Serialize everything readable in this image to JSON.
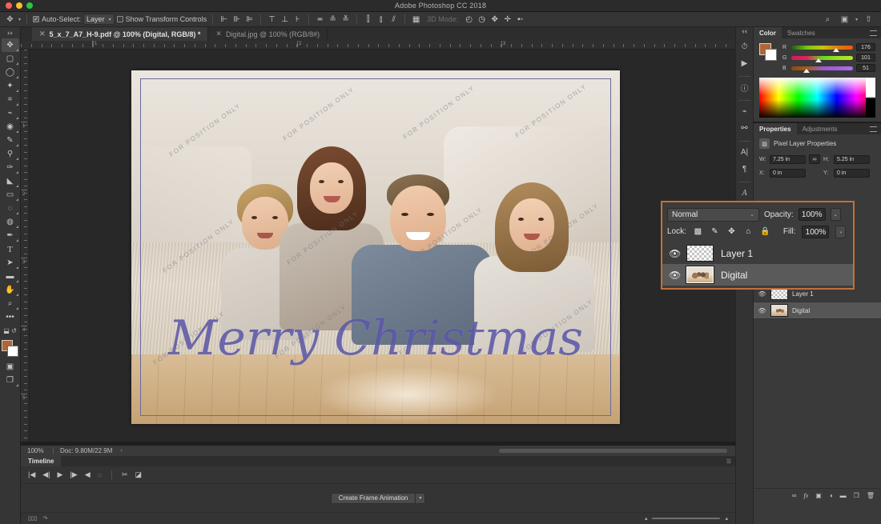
{
  "window": {
    "app_title": "Adobe Photoshop CC 2018"
  },
  "options_bar": {
    "auto_select_label": "Auto-Select:",
    "auto_select_checked": true,
    "layer_select_value": "Layer",
    "show_transform_label": "Show Transform Controls",
    "show_transform_checked": false,
    "mode_3d_label": "3D Mode:",
    "align_icons": [
      "align-left-edges-icon",
      "align-horizontal-centers-icon",
      "align-right-edges-icon",
      "align-top-edges-icon",
      "align-vertical-centers-icon",
      "align-bottom-edges-icon",
      "distribute-top-edges-icon",
      "distribute-vertical-centers-icon",
      "distribute-bottom-edges-icon",
      "distribute-left-edges-icon",
      "distribute-horizontal-centers-icon",
      "distribute-right-edges-icon"
    ],
    "right_icons": [
      "search-icon",
      "workspace-icon",
      "chevron-down-icon",
      "share-icon"
    ]
  },
  "tabs": [
    {
      "label": "5_x_7_A7_H-9.pdf @ 100% (Digital, RGB/8) *",
      "active": true
    },
    {
      "label": "Digital.jpg @ 100% (RGB/8#)",
      "active": false
    }
  ],
  "toolbar": {
    "tools": [
      {
        "name": "move-tool",
        "glyph": "✥",
        "selected": true
      },
      {
        "name": "rectangular-marquee-tool",
        "glyph": "▢"
      },
      {
        "name": "lasso-tool",
        "glyph": "◯"
      },
      {
        "name": "magic-wand-tool",
        "glyph": "✦"
      },
      {
        "name": "crop-tool",
        "glyph": "⌗"
      },
      {
        "name": "eyedropper-tool",
        "glyph": "⌁"
      },
      {
        "name": "spot-healing-brush-tool",
        "glyph": "◉"
      },
      {
        "name": "brush-tool",
        "glyph": "✎"
      },
      {
        "name": "clone-stamp-tool",
        "glyph": "⚲"
      },
      {
        "name": "history-brush-tool",
        "glyph": "✑"
      },
      {
        "name": "eraser-tool",
        "glyph": "◣"
      },
      {
        "name": "gradient-tool",
        "glyph": "▭"
      },
      {
        "name": "blur-tool",
        "glyph": "◌"
      },
      {
        "name": "dodge-tool",
        "glyph": "◍"
      },
      {
        "name": "pen-tool",
        "glyph": "✒"
      },
      {
        "name": "horizontal-type-tool",
        "glyph": "T"
      },
      {
        "name": "path-selection-tool",
        "glyph": "➤"
      },
      {
        "name": "rectangle-tool",
        "glyph": "▬"
      },
      {
        "name": "hand-tool",
        "glyph": "✋"
      },
      {
        "name": "zoom-tool",
        "glyph": "⌕"
      },
      {
        "name": "edit-toolbar-tool",
        "glyph": "•••"
      }
    ],
    "quick_mask_icon": "quick-mask-icon",
    "screen_mode_icon": "screen-mode-icon",
    "foreground_color": "#b06533",
    "background_color": "#ffffff"
  },
  "canvas": {
    "artwork_text": "Merry Christmas",
    "watermark_text": "FOR POSITION ONLY",
    "artwork_color": "#4e48a0"
  },
  "rulers": {
    "horizontal_numbers": [
      "1",
      "2",
      "3"
    ],
    "vertical_numbers": [
      "1",
      "2",
      "3",
      "4",
      "5"
    ]
  },
  "status_bar": {
    "zoom": "100%",
    "doc_info": "Doc: 9.80M/22.9M",
    "arrow": "›"
  },
  "timeline": {
    "tab_label": "Timeline",
    "create_button": "Create Frame Animation",
    "transport_icons": [
      "go-to-first-frame-icon",
      "select-previous-frame-icon",
      "play-icon",
      "select-next-frame-icon",
      "audio-icon",
      "loop-icon",
      "split-at-playhead-icon",
      "transition-icon"
    ],
    "footer_icons": [
      "frames-icon",
      "convert-to-video-timeline-icon"
    ],
    "zoom_icons": [
      "zoom-out-icon",
      "zoom-in-icon"
    ]
  },
  "dock": {
    "icons": [
      "history-icon",
      "actions-play-icon",
      "info-icon",
      "brush-settings-icon",
      "brush-presets-icon",
      "character-icon",
      "paragraph-icon",
      "glyphs-icon"
    ]
  },
  "color_panel": {
    "tabs": [
      {
        "label": "Color",
        "active": true
      },
      {
        "label": "Swatches",
        "active": false
      }
    ],
    "channels": [
      {
        "label": "R",
        "value": "176",
        "pos": 68
      },
      {
        "label": "G",
        "value": "101",
        "pos": 39
      },
      {
        "label": "B",
        "value": "51",
        "pos": 19
      }
    ]
  },
  "properties_panel": {
    "tabs": [
      {
        "label": "Properties",
        "active": true
      },
      {
        "label": "Adjustments",
        "active": false
      }
    ],
    "title": "Pixel Layer Properties",
    "title_icon": "pixel-layer-icon",
    "fields": [
      {
        "label": "W:",
        "value": "7.25 in"
      },
      {
        "label": "H:",
        "value": "5.25 in"
      },
      {
        "label": "X:",
        "value": "0 in"
      },
      {
        "label": "Y:",
        "value": "0 in"
      }
    ],
    "link_icon": "link-dimensions-icon"
  },
  "layers_popup": {
    "highlight_color": "#c4703a",
    "blend_mode": "Normal",
    "opacity_label": "Opacity:",
    "opacity_value": "100%",
    "lock_label": "Lock:",
    "lock_icons": [
      "lock-transparent-pixels-icon",
      "lock-image-pixels-icon",
      "lock-position-icon",
      "lock-artboard-nesting-icon",
      "lock-all-icon"
    ],
    "fill_label": "Fill:",
    "fill_value": "100%",
    "layers": [
      {
        "name": "Layer 1",
        "thumb": "transparent",
        "visible": true,
        "selected": false
      },
      {
        "name": "Digital",
        "thumb": "photo",
        "visible": true,
        "selected": true
      }
    ]
  },
  "layers_panel": {
    "layers": [
      {
        "name": "Layer 1",
        "thumb": "transparent",
        "visible": true,
        "selected": false
      },
      {
        "name": "Digital",
        "thumb": "photo",
        "visible": true,
        "selected": true
      }
    ],
    "footer_icons": [
      "link-layers-icon",
      "layer-style-fx-icon",
      "add-layer-mask-icon",
      "new-adjustment-layer-icon",
      "new-group-icon",
      "new-layer-icon",
      "delete-layer-icon"
    ]
  }
}
